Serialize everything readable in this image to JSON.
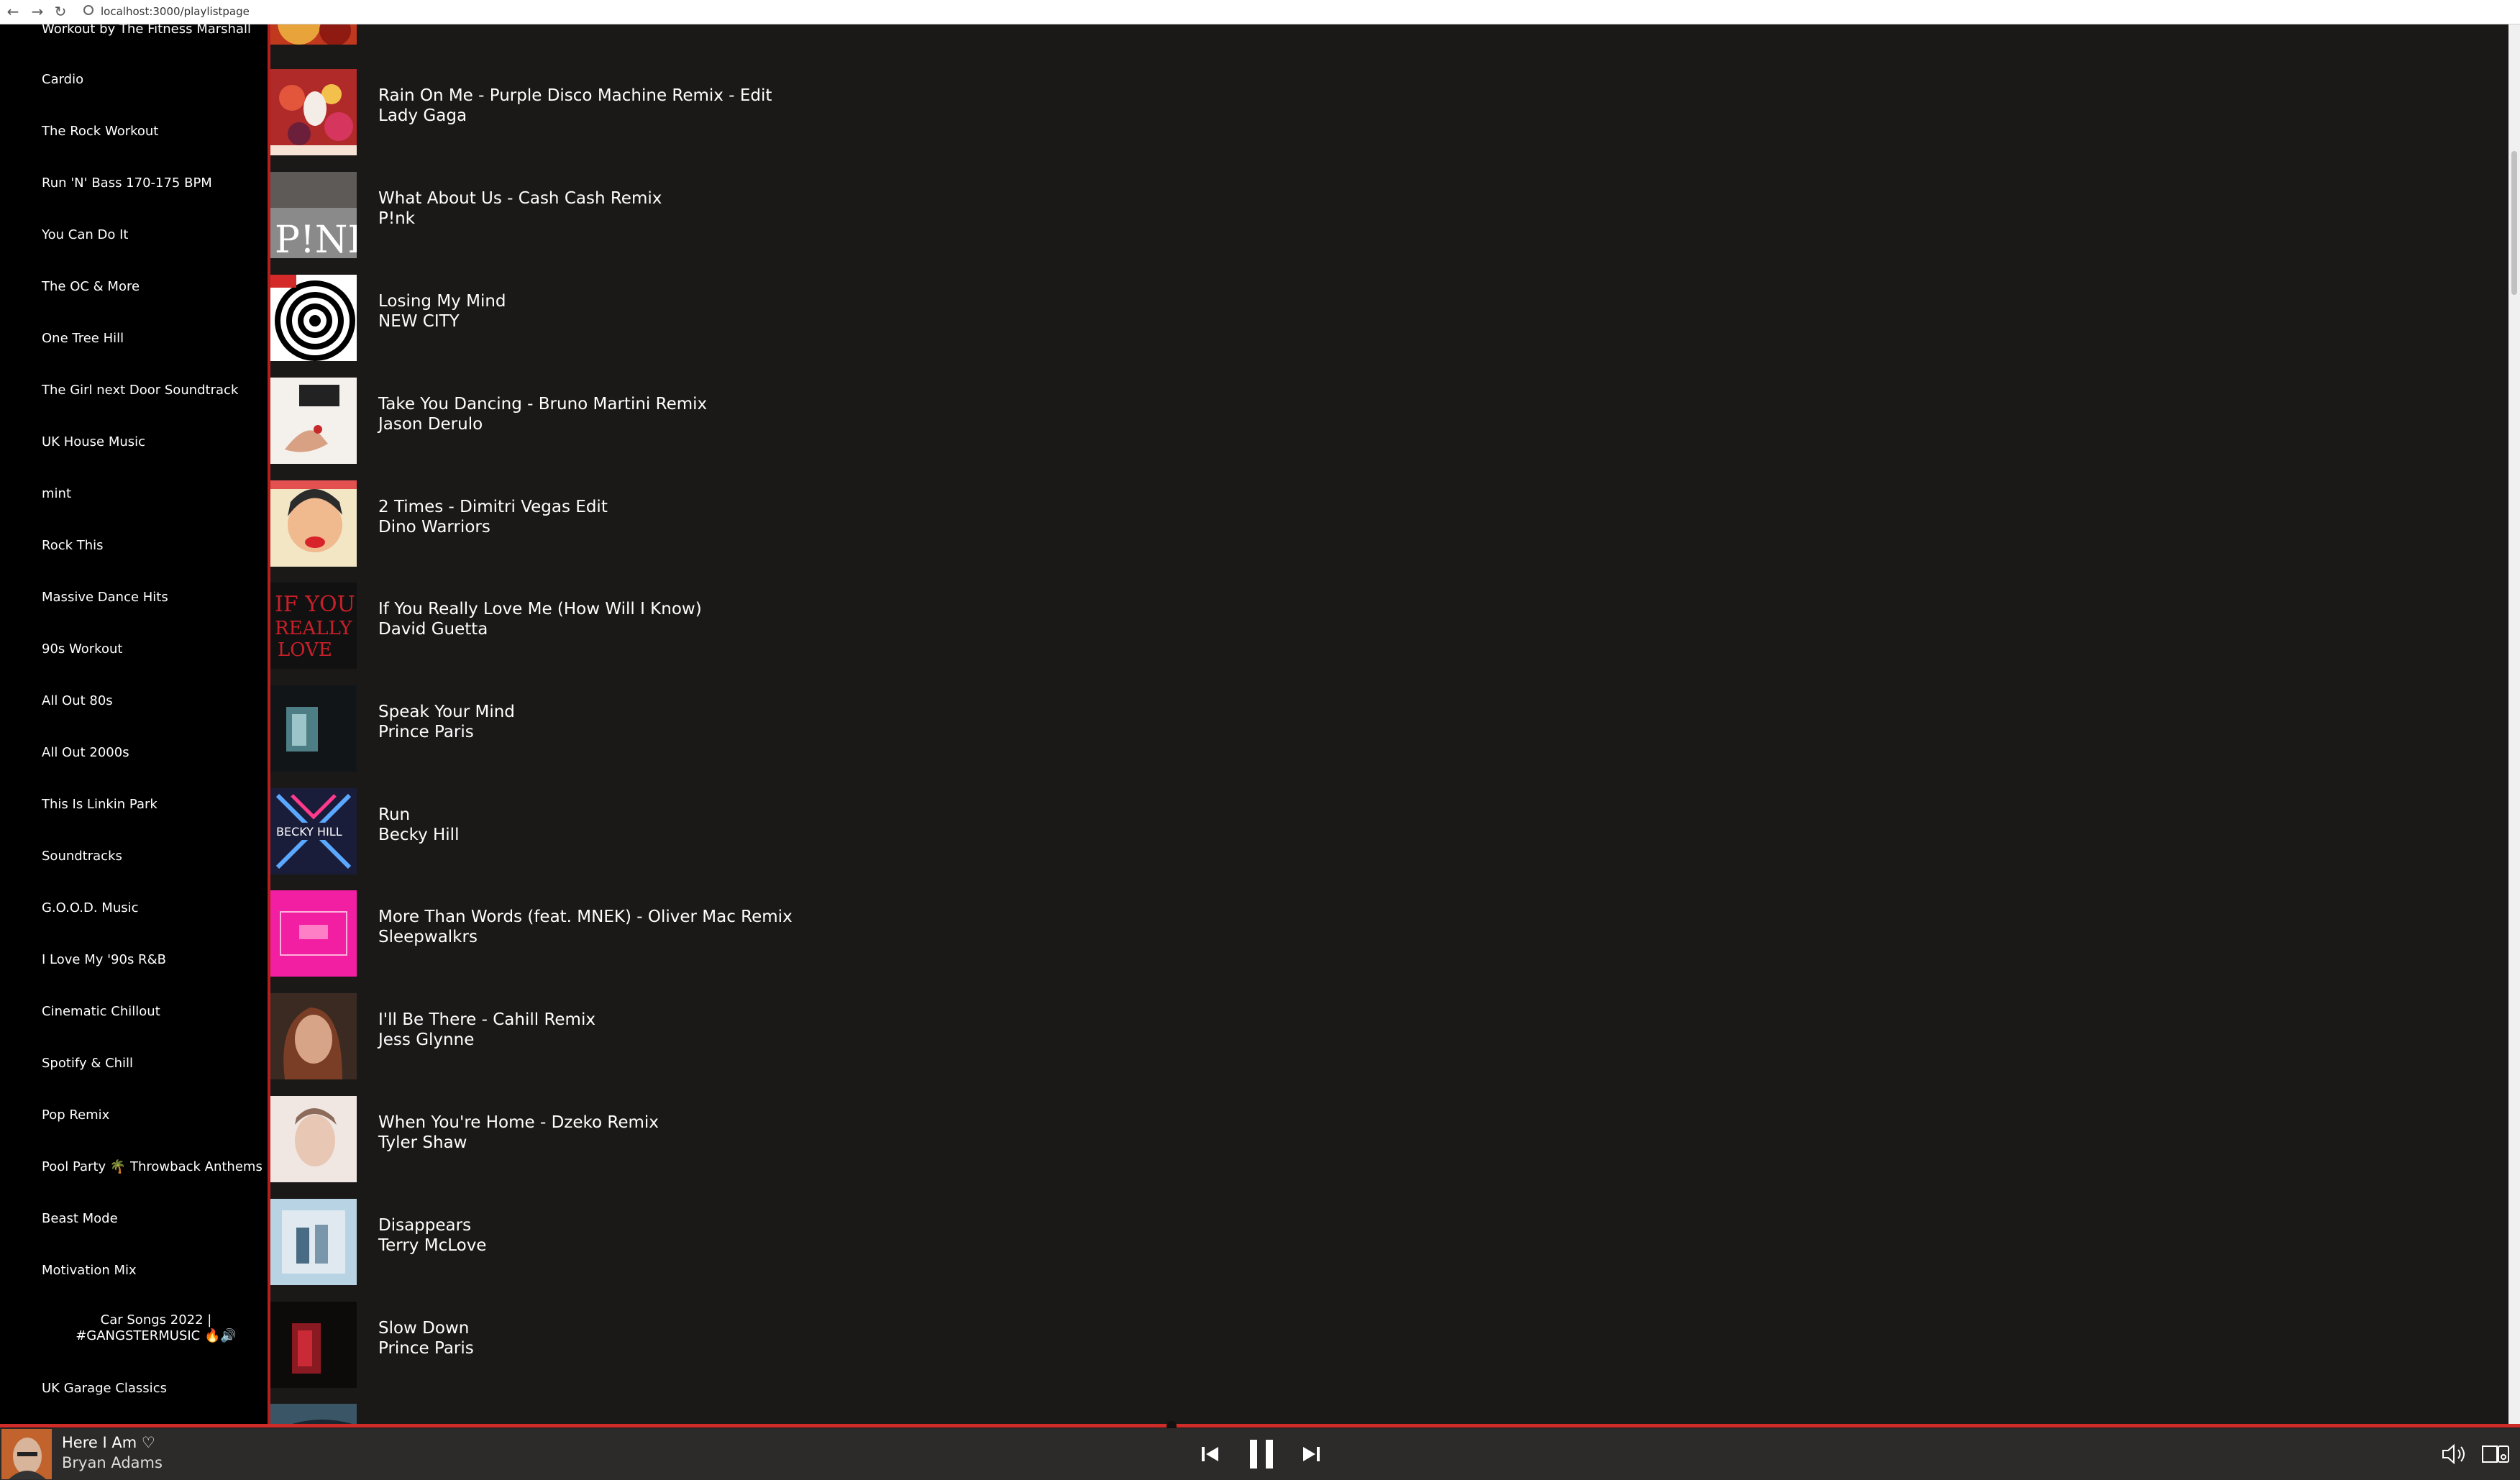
{
  "browser": {
    "url": "localhost:3000/playlistpage"
  },
  "sidebar": {
    "items": [
      {
        "label": "Workout by The Fitness Marshall"
      },
      {
        "label": "Cardio"
      },
      {
        "label": "The Rock Workout"
      },
      {
        "label": "Run 'N' Bass 170-175 BPM"
      },
      {
        "label": "You Can Do It"
      },
      {
        "label": "The OC & More"
      },
      {
        "label": "One Tree Hill"
      },
      {
        "label": "The Girl next Door Soundtrack"
      },
      {
        "label": "UK House Music"
      },
      {
        "label": "mint"
      },
      {
        "label": "Rock This"
      },
      {
        "label": "Massive Dance Hits"
      },
      {
        "label": "90s Workout"
      },
      {
        "label": "All Out 80s"
      },
      {
        "label": "All Out 2000s"
      },
      {
        "label": "This Is Linkin Park"
      },
      {
        "label": "Soundtracks"
      },
      {
        "label": "G.O.O.D. Music"
      },
      {
        "label": "I Love My '90s R&B"
      },
      {
        "label": "Cinematic Chillout"
      },
      {
        "label": "Spotify & Chill"
      },
      {
        "label": "Pop Remix"
      },
      {
        "label": "Pool Party 🌴 Throwback Anthems"
      },
      {
        "label": "Beast Mode"
      },
      {
        "label": "Motivation Mix"
      },
      {
        "label": "Car Songs 2022 | #GANGSTERMUSIC 🔥🔊"
      },
      {
        "label": "UK Garage Classics"
      }
    ]
  },
  "tracks": [
    {
      "title": "Rain On Me - Purple Disco Machine Remix - Edit",
      "artist": "Lady Gaga"
    },
    {
      "title": "What About Us - Cash Cash Remix",
      "artist": "P!nk"
    },
    {
      "title": "Losing My Mind",
      "artist": "NEW CITY"
    },
    {
      "title": "Take You Dancing - Bruno Martini Remix",
      "artist": "Jason Derulo"
    },
    {
      "title": "2 Times - Dimitri Vegas Edit",
      "artist": "Dino Warriors"
    },
    {
      "title": "If You Really Love Me (How Will I Know)",
      "artist": "David Guetta"
    },
    {
      "title": "Speak Your Mind",
      "artist": "Prince Paris"
    },
    {
      "title": "Run",
      "artist": "Becky Hill"
    },
    {
      "title": "More Than Words (feat. MNEK) - Oliver Mac Remix",
      "artist": "Sleepwalkrs"
    },
    {
      "title": "I'll Be There - Cahill Remix",
      "artist": "Jess Glynne"
    },
    {
      "title": "When You're Home - Dzeko Remix",
      "artist": "Tyler Shaw"
    },
    {
      "title": "Disappears",
      "artist": "Terry McLove"
    },
    {
      "title": "Slow Down",
      "artist": "Prince Paris"
    }
  ],
  "player": {
    "title": "Here I Am",
    "heart": "♡",
    "artist": "Bryan Adams",
    "progress": 0.465
  },
  "colors": {
    "accent": "#cf2b28",
    "background": "#1b1818",
    "sidebar": "#000000",
    "player": "#2d2a2a"
  }
}
